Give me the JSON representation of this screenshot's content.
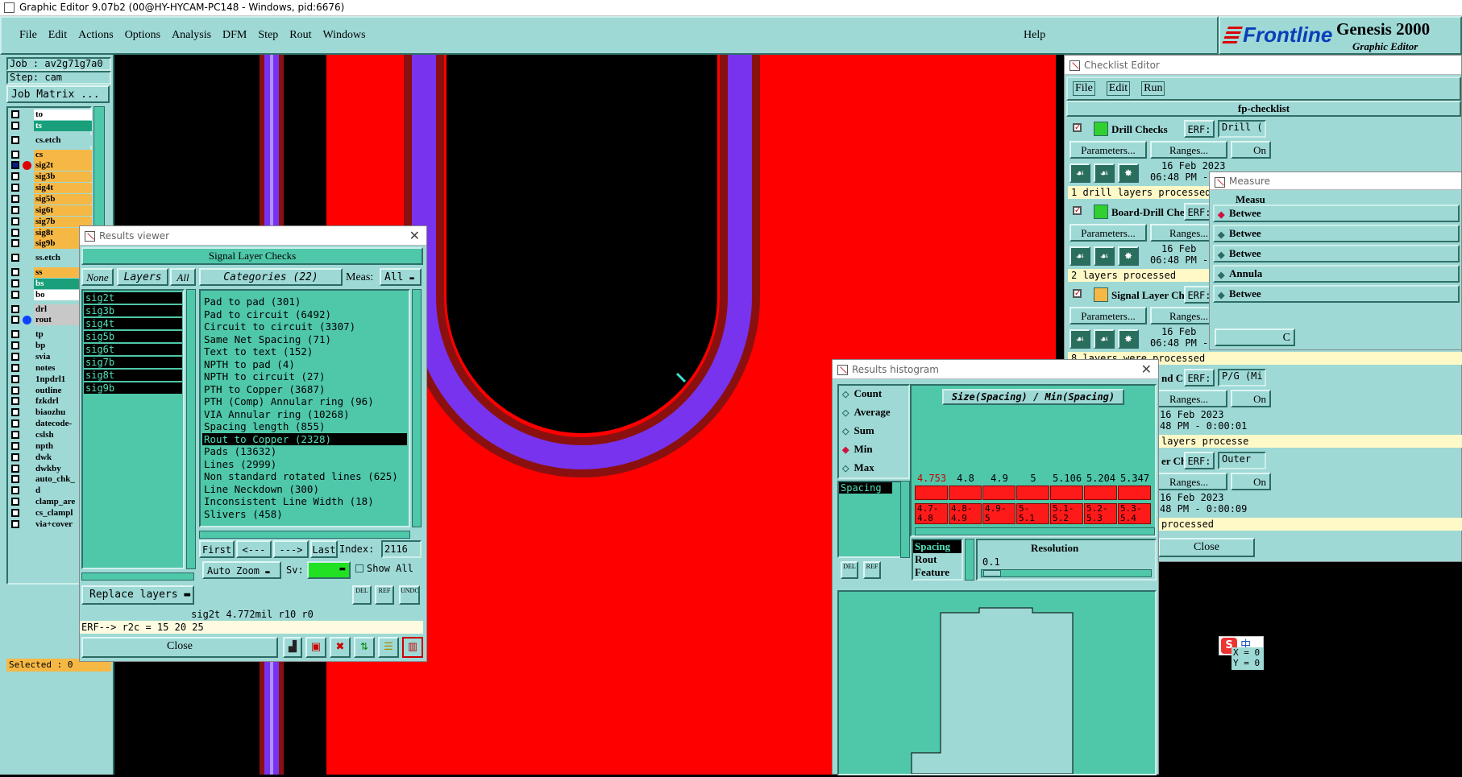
{
  "titlebar": {
    "text": "Graphic Editor 9.07b2 (00@HY-HYCAM-PC148 - Windows, pid:6676)"
  },
  "menu": {
    "items": [
      "File",
      "Edit",
      "Actions",
      "Options",
      "Analysis",
      "DFM",
      "Step",
      "Rout",
      "Windows"
    ],
    "help": "Help"
  },
  "brand": {
    "logo": "Frontline",
    "product": "Genesis 2000",
    "subtitle": "Graphic Editor"
  },
  "job": {
    "job": "Job : av2g71g7a0",
    "step": "Step: cam",
    "matrix": "Job Matrix ..."
  },
  "layers": [
    {
      "name": "to",
      "color": "#ffffff",
      "g": 0
    },
    {
      "name": "ts",
      "color": "#19a07a",
      "g": 0
    },
    {
      "name": "cs.etch",
      "color": "#9ed9d6",
      "g": 1
    },
    {
      "name": "cs",
      "color": "#f5b845",
      "g": 1
    },
    {
      "name": "sig2t",
      "color": "#f5b845",
      "g": 0,
      "active": true,
      "mark": "#e00000"
    },
    {
      "name": "sig3b",
      "color": "#f5b845",
      "g": 0
    },
    {
      "name": "sig4t",
      "color": "#f5b845",
      "g": 0
    },
    {
      "name": "sig5b",
      "color": "#f5b845",
      "g": 0
    },
    {
      "name": "sig6t",
      "color": "#f5b845",
      "g": 0
    },
    {
      "name": "sig7b",
      "color": "#f5b845",
      "g": 0
    },
    {
      "name": "sig8t",
      "color": "#f5b845",
      "g": 0
    },
    {
      "name": "sig9b",
      "color": "#f5b845",
      "g": 0
    },
    {
      "name": "ss.etch",
      "color": "#9ed9d6",
      "g": 1
    },
    {
      "name": "ss",
      "color": "#f5b845",
      "g": 1
    },
    {
      "name": "bs",
      "color": "#19a07a",
      "g": 0
    },
    {
      "name": "bo",
      "color": "#ffffff",
      "g": 0
    },
    {
      "name": "drl",
      "color": "#c8c8c8",
      "g": 1
    },
    {
      "name": "rout",
      "color": "#c8c8c8",
      "g": 0,
      "mark": "#1040ff"
    },
    {
      "name": "tp",
      "color": "#9ed9d6",
      "g": 1
    },
    {
      "name": "bp",
      "color": "#9ed9d6",
      "g": 0
    },
    {
      "name": "svia",
      "color": "#9ed9d6",
      "g": 0
    },
    {
      "name": "notes",
      "color": "#9ed9d6",
      "g": 0
    },
    {
      "name": "1npdrl1",
      "color": "#9ed9d6",
      "g": 0
    },
    {
      "name": "outline",
      "color": "#9ed9d6",
      "g": 0
    },
    {
      "name": "fzkdrl",
      "color": "#9ed9d6",
      "g": 0
    },
    {
      "name": "biaozhu",
      "color": "#9ed9d6",
      "g": 0
    },
    {
      "name": "datecode-",
      "color": "#9ed9d6",
      "g": 0
    },
    {
      "name": "cslsh",
      "color": "#9ed9d6",
      "g": 0
    },
    {
      "name": "npth",
      "color": "#9ed9d6",
      "g": 0
    },
    {
      "name": "dwk",
      "color": "#9ed9d6",
      "g": 0
    },
    {
      "name": "dwkby",
      "color": "#9ed9d6",
      "g": 0
    },
    {
      "name": "auto_chk_",
      "color": "#9ed9d6",
      "g": 0
    },
    {
      "name": "d",
      "color": "#9ed9d6",
      "g": 0
    },
    {
      "name": "clamp_are",
      "color": "#9ed9d6",
      "g": 0
    },
    {
      "name": "cs_clampl",
      "color": "#9ed9d6",
      "g": 0
    },
    {
      "name": "via+cover",
      "color": "#9ed9d6",
      "g": 0
    }
  ],
  "selected": "Selected : 0",
  "results_viewer": {
    "title": "Results viewer",
    "header": "Signal Layer Checks",
    "none": "None",
    "layers_label": "Layers",
    "all": "All",
    "layer_list": [
      "sig2t",
      "sig3b",
      "sig4t",
      "sig5b",
      "sig6t",
      "sig7b",
      "sig8t",
      "sig9b"
    ],
    "categories_label": "Categories (22)",
    "meas_label": "Meas:",
    "meas_value": "All",
    "categories": [
      "Pad to pad (301)",
      "Pad to circuit (6492)",
      "Circuit to circuit (3307)",
      "Same Net Spacing (71)",
      "Text to text (152)",
      "NPTH to pad (4)",
      "NPTH to circuit (27)",
      "PTH to Copper (3687)",
      "PTH (Comp) Annular ring (96)",
      "VIA Annular ring (10268)",
      "Spacing length (855)",
      "Rout to Copper (2328)",
      "Pads (13632)",
      "Lines (2999)",
      "Non standard rotated lines (625)",
      "Line Neckdown (300)",
      "Inconsistent Line Width (18)",
      "Slivers (458)"
    ],
    "selected_category": "Rout to Copper (2328)",
    "first": "First",
    "prev": "<---",
    "next": "--->",
    "last": "Last",
    "index_label": "Index:",
    "index_value": "2116",
    "auto_zoom": "Auto Zoom",
    "sv": "Sv:",
    "show_all": "Show All",
    "replace_layers": "Replace layers",
    "del": "DEL",
    "ref": "REF",
    "undo": "UNDO",
    "status": "sig2t 4.772mil  r10  r0",
    "erf": "ERF--> r2c = 15 20 25",
    "close": "Close"
  },
  "checklist": {
    "title": "Checklist Editor",
    "menu": [
      "File",
      "Edit",
      "Run"
    ],
    "name": "fp-checklist",
    "checks": [
      {
        "name": "Drill Checks",
        "erf_label": "ERF:",
        "erf": "Drill (",
        "params": "Parameters...",
        "ranges": "Ranges...",
        "on": "On",
        "date": "16 Feb 2023",
        "time": "06:48 PM -",
        "status": "1 drill layers processed"
      },
      {
        "name": "Board-Drill Che",
        "erf_label": "ERF:",
        "erf": "",
        "params": "Parameters...",
        "ranges": "Ranges...",
        "on": "On",
        "date": "16 Feb",
        "time": "06:48 PM -",
        "status": "2 layers processed"
      },
      {
        "name": "Signal Layer Ch",
        "erf_label": "ERF:",
        "erf": "",
        "params": "Parameters...",
        "ranges": "Ranges...",
        "on": "On",
        "date": "16 Feb",
        "time": "06:48 PM -",
        "status": "8 layers were processed"
      },
      {
        "name": "nd C",
        "erf_label": "ERF:",
        "erf": "P/G (Mi",
        "params": "",
        "ranges": "Ranges...",
        "on": "On",
        "date": "16 Feb 2023",
        "time": "48 PM - 0:00:01",
        "status": "layers processe"
      },
      {
        "name": "er Ch",
        "erf_label": "ERF:",
        "erf": "Outer",
        "params": "",
        "ranges": "Ranges...",
        "on": "On",
        "date": "16 Feb 2023",
        "time": "48 PM - 0:00:09",
        "status": "processed"
      }
    ],
    "close": "Close"
  },
  "measure": {
    "title": "Measure",
    "header": "Measu",
    "options": [
      "Betwee",
      "Betwee",
      "Betwee",
      "Annula",
      "Betwee"
    ],
    "close": "C"
  },
  "histogram": {
    "title": "Results histogram",
    "chart_title": "Size(Spacing) / Min(Spacing)",
    "modes": [
      "Count",
      "Average",
      "Sum",
      "Min",
      "Max"
    ],
    "mode_selected": "Min",
    "list": [
      "Spacing"
    ],
    "values": [
      "4.753",
      "4.8",
      "4.9",
      "5",
      "5.106",
      "5.204",
      "5.347"
    ],
    "ranges": [
      "4.7-\n4.8",
      "4.8-\n4.9",
      "4.9-\n5",
      "5-\n5.1",
      "5.1-\n5.2",
      "5.2-\n5.3",
      "5.3-\n5.4"
    ],
    "meas_list": [
      "Spacing",
      "Rout",
      "Feature"
    ],
    "resolution_label": "Resolution",
    "resolution": "0.1",
    "del": "DEL",
    "ref": "REF"
  },
  "coords": {
    "x": "X = 0",
    "y": "Y = 0"
  },
  "ime": "中"
}
